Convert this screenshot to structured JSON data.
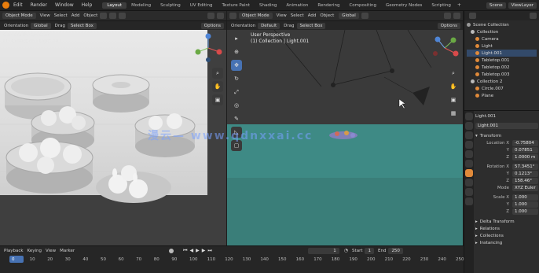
{
  "menubar": {
    "items": [
      "Edit",
      "Render",
      "Window",
      "Help"
    ],
    "tabs": [
      "Layout",
      "Modeling",
      "Sculpting",
      "UV Editing",
      "Texture Paint",
      "Shading",
      "Animation",
      "Rendering",
      "Compositing",
      "Geometry Nodes",
      "Scripting"
    ],
    "active_tab": "Layout",
    "scene": "Scene",
    "view_layer": "ViewLayer"
  },
  "left_view": {
    "mode": "Object Mode",
    "menu": [
      "View",
      "Select",
      "Add",
      "Object"
    ],
    "transform": "Global",
    "drag_label": "Drag",
    "select": "Select Box",
    "options": "Options",
    "overlay_line1": "Camera Perspective",
    "overlay_line2": "(1) Collection | Light.001"
  },
  "right_view": {
    "mode": "Object Mode",
    "menu": [
      "View",
      "Select",
      "Add",
      "Object"
    ],
    "transform": "Global",
    "drag_label": "Drag",
    "select": "Select Box",
    "options": "Options",
    "orientation": "Orientation",
    "default": "Default",
    "overlay_line1": "User Perspective",
    "overlay_line2": "(1) Collection | Light.001"
  },
  "watermark": "漫云— www.qdnxxai.cc",
  "outliner": {
    "root": "Scene Collection",
    "items": [
      "Collection",
      "Camera",
      "Light",
      "Light.001",
      "Tabletop.001",
      "Tabletop.002",
      "Tabletop.003",
      "Collection 2",
      "Circle.007",
      "Plane"
    ]
  },
  "properties": {
    "object_name": "Light.001",
    "data_name": "Light.001",
    "section": "Transform",
    "location_label": "Location X",
    "location": [
      "-0.75804 m",
      "0.07851 m",
      "1.0000 m"
    ],
    "rotation_label": "Rotation X",
    "rotation": [
      "57.3451°",
      "0.1213°",
      "158.46°"
    ],
    "mode_label": "Mode",
    "mode_value": "XYZ Euler",
    "scale_label": "Scale X",
    "scale": [
      "1.000",
      "1.000",
      "1.000"
    ],
    "axis_y": "Y",
    "axis_z": "Z",
    "sections": [
      "Delta Transform",
      "Relations",
      "Collections",
      "Instancing"
    ]
  },
  "timeline": {
    "menu": [
      "Playback",
      "Keying",
      "View",
      "Marker"
    ],
    "current_frame": "1",
    "start_label": "Start",
    "start": "1",
    "end_label": "End",
    "end": "250",
    "ticks": [
      "0",
      "10",
      "20",
      "30",
      "40",
      "50",
      "60",
      "70",
      "80",
      "90",
      "100",
      "110",
      "120",
      "130",
      "140",
      "150",
      "160",
      "170",
      "180",
      "190",
      "200",
      "210",
      "220",
      "230",
      "240",
      "250"
    ]
  },
  "colors": {
    "accent": "#4772b3",
    "ground": "#3e8a85",
    "orange": "#e08a3a"
  }
}
